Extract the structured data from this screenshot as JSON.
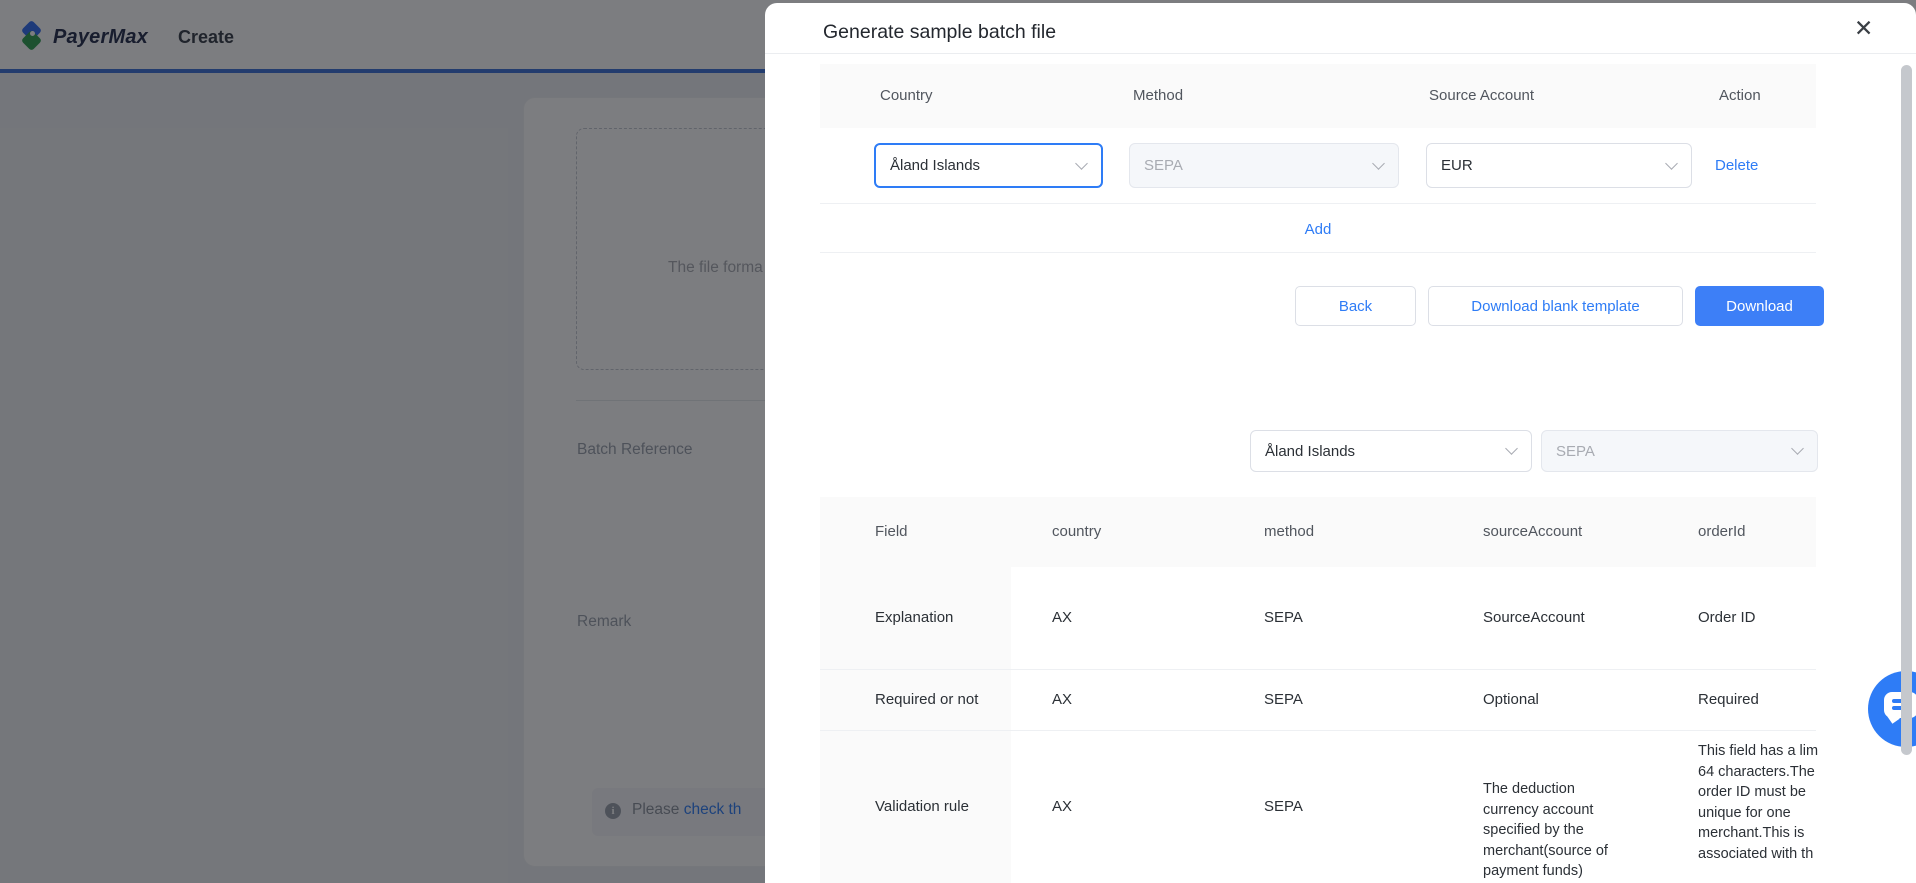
{
  "background": {
    "brand": "PayerMax",
    "page_title": "Create",
    "upload_hint": "The file forma",
    "labels": {
      "batch_reference": "Batch Reference",
      "remark": "Remark"
    },
    "notice": {
      "prefix": "Please ",
      "link_text": "check th",
      "icon": "i"
    }
  },
  "modal": {
    "title": "Generate sample batch file",
    "close_glyph": "✕",
    "selector_table": {
      "headers": [
        "Country",
        "Method",
        "Source Account",
        "Action"
      ],
      "row": {
        "country_value": "Åland Islands",
        "method_value": "SEPA",
        "source_account_value": "EUR",
        "action_label": "Delete"
      }
    },
    "add_label": "Add",
    "buttons": {
      "back": "Back",
      "blank_template": "Download blank template",
      "download": "Download"
    },
    "preview_filters": {
      "country_value": "Åland Islands",
      "method_value": "SEPA"
    },
    "field_table": {
      "headers": [
        "Field",
        "country",
        "method",
        "sourceAccount",
        "orderId"
      ],
      "rows": [
        {
          "label": "Explanation",
          "country": "AX",
          "method": "SEPA",
          "sourceAccount": "SourceAccount",
          "orderId": "Order ID"
        },
        {
          "label": "Required or not",
          "country": "AX",
          "method": "SEPA",
          "sourceAccount": "Optional",
          "orderId": "Required"
        },
        {
          "label": "Validation rule",
          "country": "AX",
          "method": "SEPA",
          "sourceAccount_lines": [
            "The deduction",
            "currency account",
            "specified by the",
            "merchant(source of",
            "payment funds)"
          ],
          "orderId_lines": [
            "This field has a lim",
            "64 characters.The",
            "order ID must be",
            "unique for one",
            "merchant.This is",
            "associated with th"
          ]
        }
      ]
    }
  },
  "colors": {
    "accent_link": "#2e7cf6",
    "primary_button": "#3d7ff7",
    "tab_line": "#3a6fd8",
    "table_header_bg": "#fafafa",
    "scrollbar_thumb": "#c5c8cd",
    "chat_fab": "#2e7cf6",
    "overlay": "rgba(17,19,24,0.55)"
  }
}
